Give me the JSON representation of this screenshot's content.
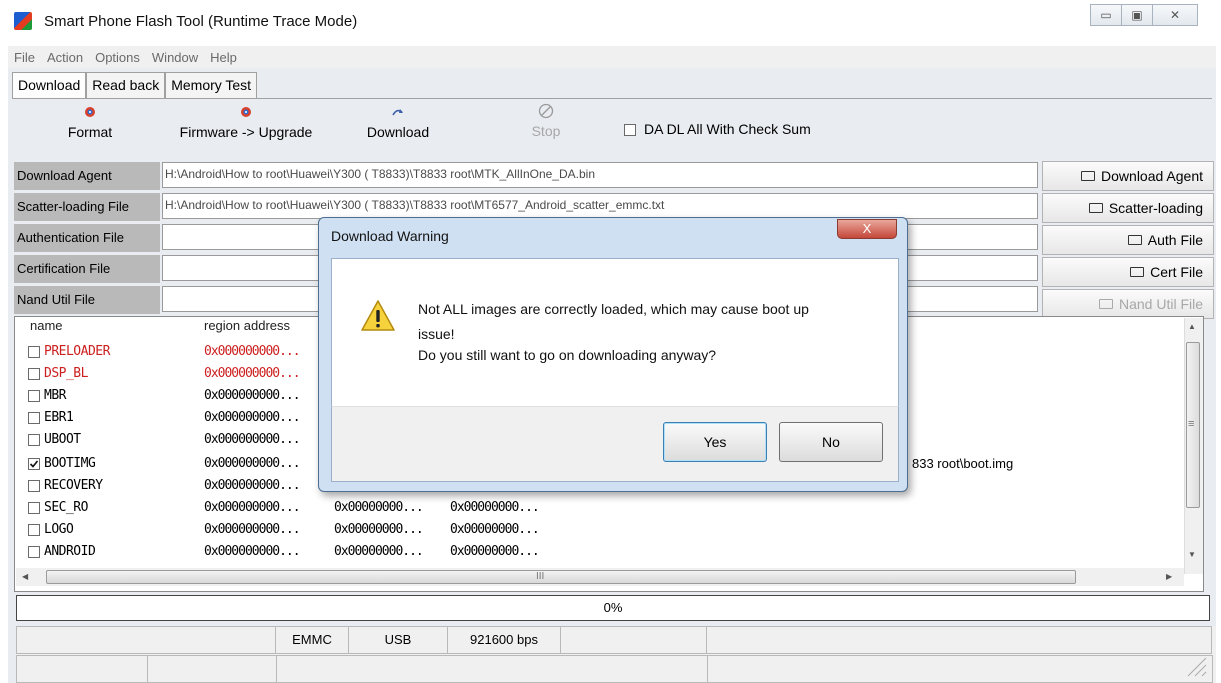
{
  "window": {
    "title": "Smart Phone Flash Tool (Runtime Trace Mode)",
    "controls": {
      "minimize": "▭",
      "maximize": "▣",
      "close": "✕"
    }
  },
  "menu": [
    "File",
    "Action",
    "Options",
    "Window",
    "Help"
  ],
  "tabs": [
    "Download",
    "Read back",
    "Memory Test"
  ],
  "toolbar": {
    "format": "Format",
    "firmware_upgrade": "Firmware -> Upgrade",
    "download": "Download",
    "stop": "Stop",
    "da_checksum": "DA DL All With Check Sum"
  },
  "fields": {
    "download_agent": {
      "label": "Download Agent",
      "value": "H:\\Android\\How to root\\Huawei\\Y300 ( T8833)\\T8833 root\\MTK_AllInOne_DA.bin",
      "button": "Download Agent"
    },
    "scatter": {
      "label": "Scatter-loading File",
      "value": "H:\\Android\\How to root\\Huawei\\Y300 ( T8833)\\T8833 root\\MT6577_Android_scatter_emmc.txt",
      "button": "Scatter-loading"
    },
    "auth": {
      "label": "Authentication File",
      "value": "",
      "button": "Auth File"
    },
    "cert": {
      "label": "Certification File",
      "value": "",
      "button": "Cert File"
    },
    "nand": {
      "label": "Nand Util File",
      "value": "",
      "button": "Nand Util File"
    }
  },
  "list": {
    "headers": [
      "name",
      "region address"
    ],
    "rows": [
      {
        "name": "PRELOADER",
        "addr": "0x000000000...",
        "col3": "",
        "col4": "",
        "checked": false,
        "red": true
      },
      {
        "name": "DSP_BL",
        "addr": "0x000000000...",
        "col3": "",
        "col4": "",
        "checked": false,
        "red": true
      },
      {
        "name": "MBR",
        "addr": "0x000000000...",
        "col3": "",
        "col4": "",
        "checked": false,
        "red": false
      },
      {
        "name": "EBR1",
        "addr": "0x000000000...",
        "col3": "",
        "col4": "",
        "checked": false,
        "red": false
      },
      {
        "name": "UBOOT",
        "addr": "0x000000000...",
        "col3": "",
        "col4": "",
        "checked": false,
        "red": false
      },
      {
        "name": "BOOTIMG",
        "addr": "0x000000000...",
        "col3": "",
        "col4": "",
        "checked": true,
        "red": false
      },
      {
        "name": "RECOVERY",
        "addr": "0x000000000...",
        "col3": "",
        "col4": "",
        "checked": false,
        "red": false
      },
      {
        "name": "SEC_RO",
        "addr": "0x000000000...",
        "col3": "0x00000000...",
        "col4": "0x00000000...",
        "checked": false,
        "red": false
      },
      {
        "name": "LOGO",
        "addr": "0x000000000...",
        "col3": "0x00000000...",
        "col4": "0x00000000...",
        "checked": false,
        "red": false
      },
      {
        "name": "ANDROID",
        "addr": "0x000000000...",
        "col3": "0x00000000...",
        "col4": "0x00000000...",
        "checked": false,
        "red": false
      }
    ],
    "bootimg_path_fragment": "833 root\\boot.img",
    "hscroll_marker": "III",
    "vscroll_marker": "≡"
  },
  "progress": {
    "text": "0%",
    "value": 0
  },
  "status": {
    "storage": "EMMC",
    "port": "USB",
    "baud": "921600 bps"
  },
  "dialog": {
    "title": "Download Warning",
    "close": "X",
    "message_line1": "Not ALL images are correctly loaded, which may cause boot up",
    "message_line2": "issue!",
    "message_line3": "Do you still want to go on downloading anyway?",
    "yes": "Yes",
    "no": "No"
  }
}
